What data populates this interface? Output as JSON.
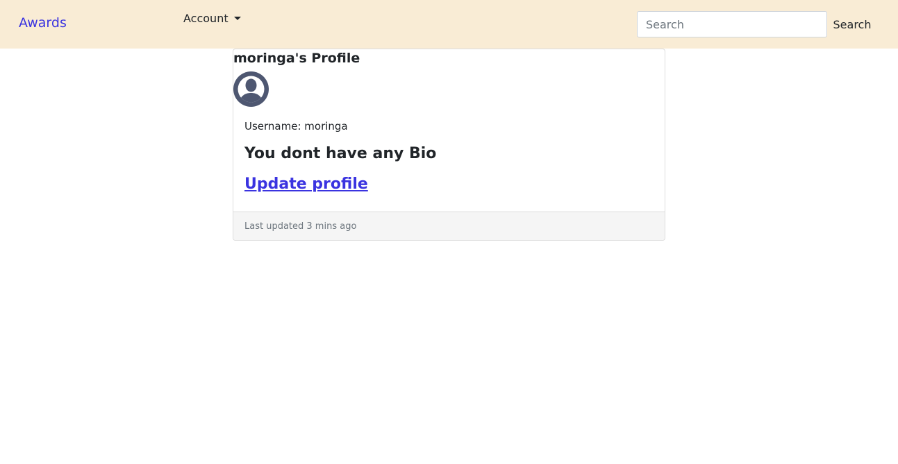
{
  "navbar": {
    "brand": "Awards",
    "account_label": "Account",
    "search": {
      "placeholder": "Search",
      "value": "",
      "button_label": "Search"
    },
    "background": "#f9ecd5",
    "link_color": "#3a33e0"
  },
  "profile": {
    "title": "moringa's Profile",
    "avatar_icon": "user-avatar-icon",
    "username_text": "Username: moringa",
    "bio_text": "You dont have any Bio",
    "update_link": "Update profile",
    "footer_text": "Last updated 3 mins ago"
  }
}
